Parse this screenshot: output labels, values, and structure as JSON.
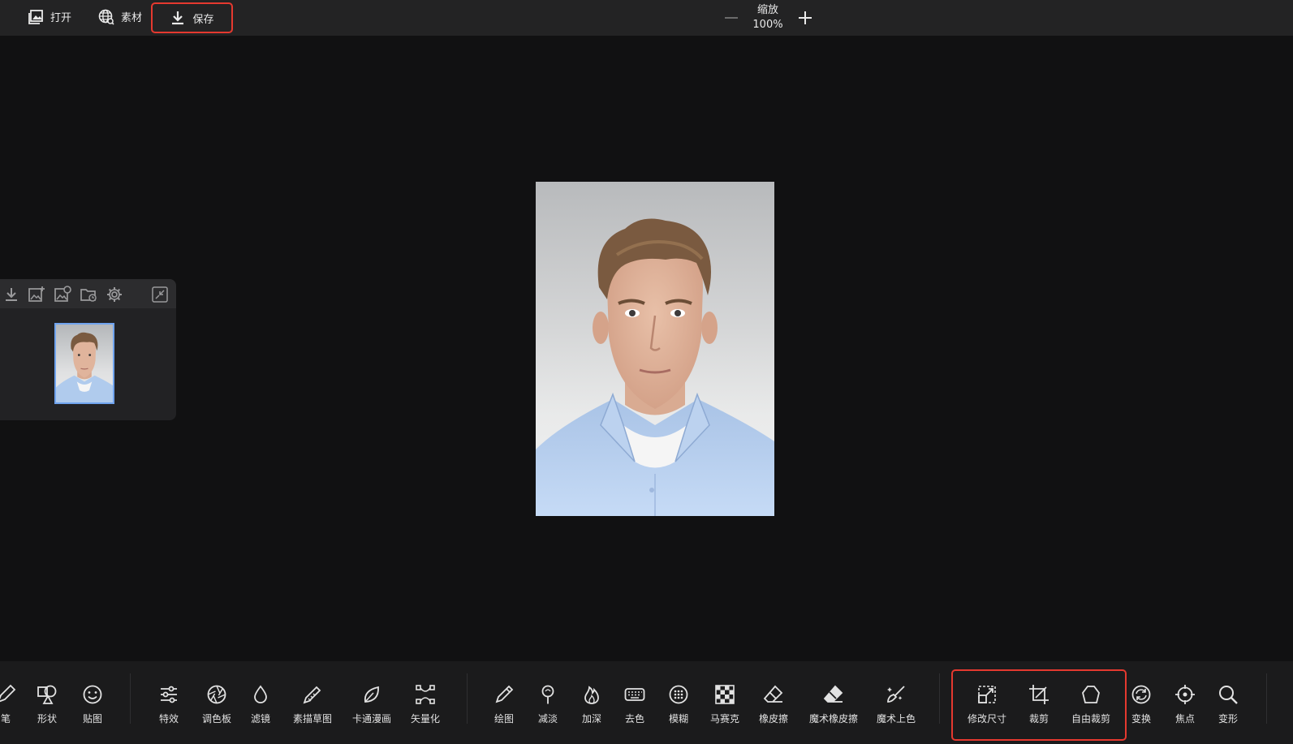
{
  "topbar": {
    "open_label": "打开",
    "material_label": "素材",
    "save_label": "保存",
    "zoom_label": "缩放",
    "zoom_value": "100%"
  },
  "tools_group1": [
    {
      "label": "笔",
      "icon": "pen-icon"
    },
    {
      "label": "形状",
      "icon": "shapes-icon"
    },
    {
      "label": "贴图",
      "icon": "smiley-sticker-icon"
    }
  ],
  "tools_group2": [
    {
      "label": "特效",
      "icon": "sliders-icon"
    },
    {
      "label": "调色板",
      "icon": "aperture-palette-icon"
    },
    {
      "label": "滤镜",
      "icon": "drop-filter-icon"
    },
    {
      "label": "素描草图",
      "icon": "pencil-sketch-icon"
    },
    {
      "label": "卡通漫画",
      "icon": "leaf-cartoon-icon"
    },
    {
      "label": "矢量化",
      "icon": "vector-nodes-icon"
    }
  ],
  "tools_group3": [
    {
      "label": "绘图",
      "icon": "draw-pencil-icon"
    },
    {
      "label": "减淡",
      "icon": "dodge-icon"
    },
    {
      "label": "加深",
      "icon": "burn-flame-icon"
    },
    {
      "label": "去色",
      "icon": "keyboard-desaturate-icon"
    },
    {
      "label": "模糊",
      "icon": "blur-dots-icon"
    },
    {
      "label": "马赛克",
      "icon": "mosaic-checker-icon"
    },
    {
      "label": "橡皮擦",
      "icon": "eraser-icon"
    },
    {
      "label": "魔术橡皮擦",
      "icon": "magic-eraser-icon"
    },
    {
      "label": "魔术上色",
      "icon": "magic-brush-icon"
    }
  ],
  "tools_group4": [
    {
      "label": "修改尺寸",
      "icon": "resize-icon"
    },
    {
      "label": "裁剪",
      "icon": "crop-icon"
    },
    {
      "label": "自由裁剪",
      "icon": "free-crop-pentagon-icon"
    },
    {
      "label": "变换",
      "icon": "transform-rotate-icon"
    },
    {
      "label": "焦点",
      "icon": "focus-target-icon"
    },
    {
      "label": "变形",
      "icon": "magnifier-deform-icon"
    }
  ],
  "layers_panel_tools": [
    "download-icon",
    "add-image-icon",
    "image-settings-icon",
    "folder-history-icon",
    "gear-icon",
    "collapse-icon"
  ],
  "colors": {
    "accent_highlight": "#e5392f",
    "thumbnail_border": "#6fa3ee"
  }
}
